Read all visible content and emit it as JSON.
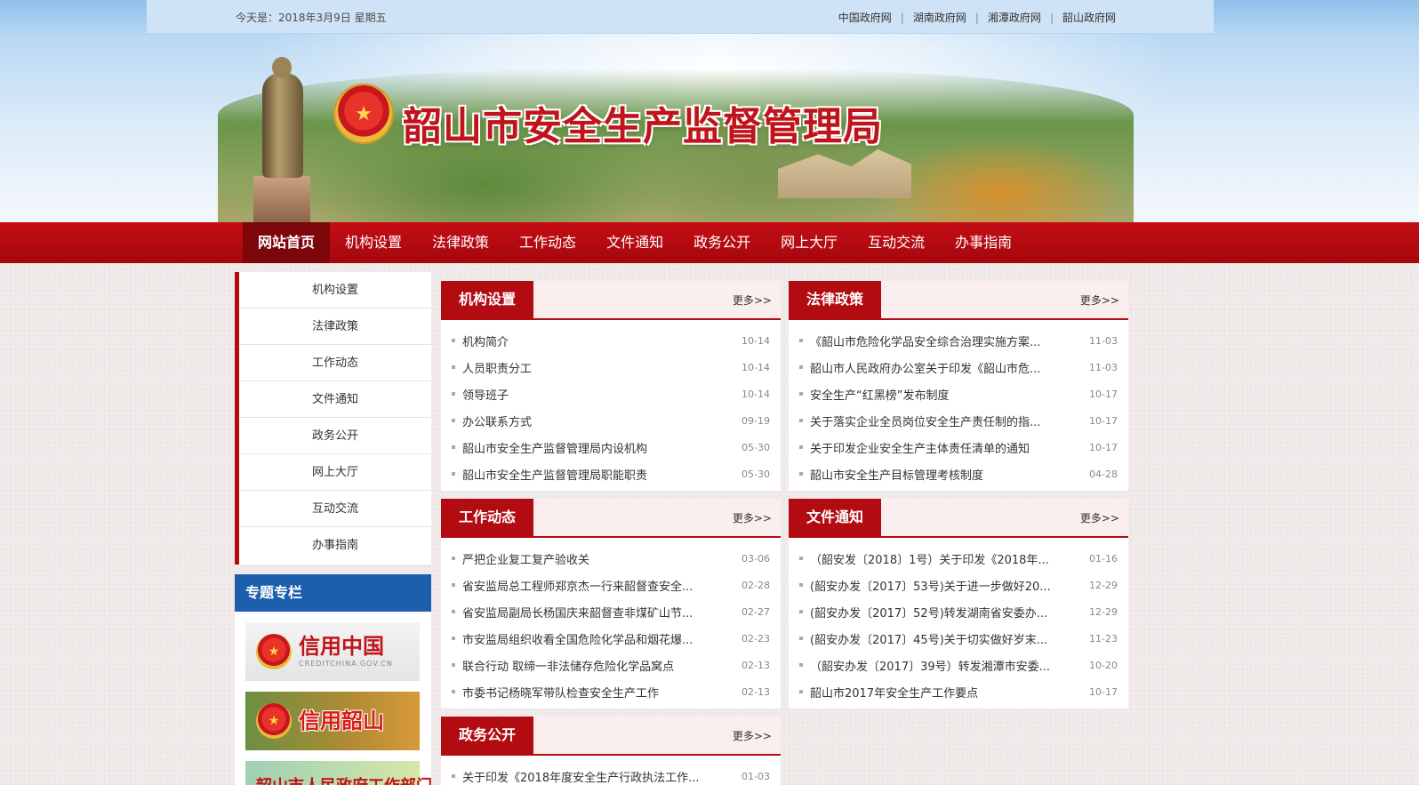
{
  "topbar": {
    "today": "今天是：2018年3月9日  星期五",
    "links": [
      "中国政府网",
      "湖南政府网",
      "湘潭政府网",
      "韶山政府网"
    ],
    "separator": "|"
  },
  "banner": {
    "title": "韶山市安全生产监督管理局",
    "emblem_glyph": "★"
  },
  "nav": {
    "items": [
      "网站首页",
      "机构设置",
      "法律政策",
      "工作动态",
      "文件通知",
      "政务公开",
      "网上大厅",
      "互动交流",
      "办事指南"
    ],
    "active_index": 0
  },
  "leftmenu": {
    "items": [
      "机构设置",
      "法律政策",
      "工作动态",
      "文件通知",
      "政务公开",
      "网上大厅",
      "互动交流",
      "办事指南"
    ]
  },
  "special": {
    "title": "专题专栏",
    "promos": [
      {
        "title": "信用中国",
        "url_text": "CREDITCHINA.GOV.CN"
      },
      {
        "title": "信用韶山"
      },
      {
        "title": "韶山市人民政府工作部门"
      }
    ]
  },
  "more_label": "更多>>",
  "panels": {
    "jigou": {
      "title": "机构设置",
      "items": [
        {
          "text": "机构简介",
          "date": "10-14"
        },
        {
          "text": "人员职责分工",
          "date": "10-14"
        },
        {
          "text": "领导班子",
          "date": "10-14"
        },
        {
          "text": "办公联系方式",
          "date": "09-19"
        },
        {
          "text": "韶山市安全生产监督管理局内设机构",
          "date": "05-30"
        },
        {
          "text": "韶山市安全生产监督管理局职能职责",
          "date": "05-30"
        }
      ]
    },
    "falv": {
      "title": "法律政策",
      "items": [
        {
          "text": "《韶山市危险化学品安全综合治理实施方案...",
          "date": "11-03"
        },
        {
          "text": "韶山市人民政府办公室关于印发《韶山市危...",
          "date": "11-03"
        },
        {
          "text": "安全生产“红黑榜”发布制度",
          "date": "10-17"
        },
        {
          "text": "关于落实企业全员岗位安全生产责任制的指...",
          "date": "10-17"
        },
        {
          "text": "关于印发企业安全生产主体责任清单的通知",
          "date": "10-17"
        },
        {
          "text": "韶山市安全生产目标管理考核制度",
          "date": "04-28"
        }
      ]
    },
    "gongzuo": {
      "title": "工作动态",
      "items": [
        {
          "text": "严把企业复工复产验收关",
          "date": "03-06"
        },
        {
          "text": "省安监局总工程师郑京杰一行来韶督查安全...",
          "date": "02-28"
        },
        {
          "text": "省安监局副局长杨国庆来韶督查非煤矿山节...",
          "date": "02-27"
        },
        {
          "text": "市安监局组织收看全国危险化学品和烟花爆...",
          "date": "02-23"
        },
        {
          "text": "联合行动 取缔一非法储存危险化学品窝点",
          "date": "02-13"
        },
        {
          "text": "市委书记杨晓军带队检查安全生产工作",
          "date": "02-13"
        }
      ]
    },
    "wenjian": {
      "title": "文件通知",
      "items": [
        {
          "text": "（韶安发〔2018〕1号）关于印发《2018年...",
          "date": "01-16"
        },
        {
          "text": "(韶安办发〔2017〕53号)关于进一步做好20...",
          "date": "12-29"
        },
        {
          "text": "(韶安办发〔2017〕52号)转发湖南省安委办...",
          "date": "12-29"
        },
        {
          "text": "(韶安办发〔2017〕45号)关于切实做好岁末...",
          "date": "11-23"
        },
        {
          "text": "（韶安办发〔2017〕39号）转发湘潭市安委...",
          "date": "10-20"
        },
        {
          "text": "韶山市2017年安全生产工作要点",
          "date": "10-17"
        }
      ]
    },
    "zhengwu": {
      "title": "政务公开",
      "items": [
        {
          "text": "关于印发《2018年度安全生产行政执法工作...",
          "date": "01-03"
        }
      ]
    }
  }
}
